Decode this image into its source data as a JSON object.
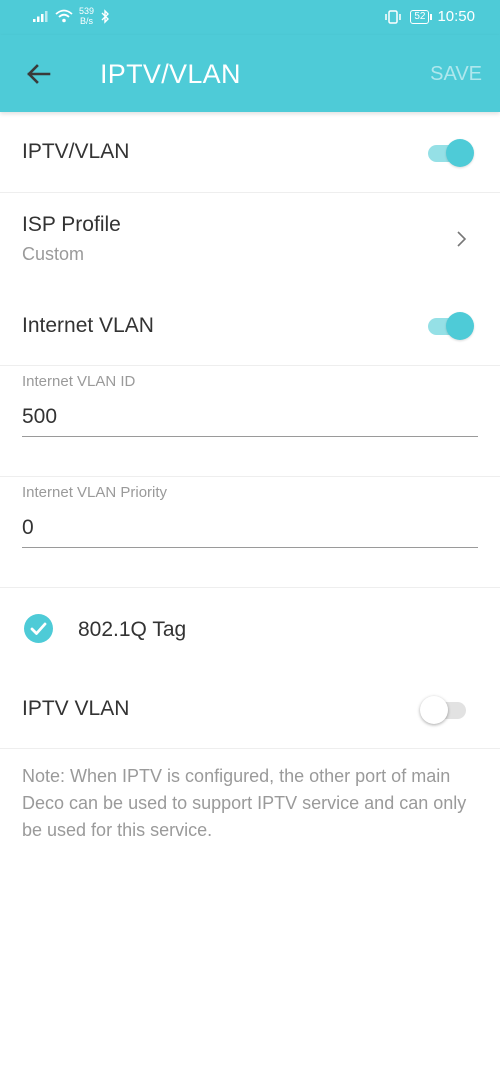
{
  "status_bar": {
    "net_speed_value": "539",
    "net_speed_unit": "B/s",
    "battery": "52",
    "time": "10:50"
  },
  "app_bar": {
    "title": "IPTV/VLAN",
    "save_label": "SAVE"
  },
  "settings": {
    "iptv_vlan_master": {
      "label": "IPTV/VLAN",
      "enabled": true
    },
    "isp_profile": {
      "label": "ISP Profile",
      "value": "Custom"
    },
    "internet_vlan": {
      "label": "Internet VLAN",
      "enabled": true
    },
    "internet_vlan_id": {
      "label": "Internet VLAN ID",
      "value": "500"
    },
    "internet_vlan_priority": {
      "label": "Internet VLAN Priority",
      "value": "0"
    },
    "tag_8021q": {
      "label": "802.1Q Tag",
      "checked": true
    },
    "iptv_vlan": {
      "label": "IPTV VLAN",
      "enabled": false
    }
  },
  "note": "Note: When IPTV is configured, the other port of main Deco can be used to support IPTV service and can only be used for this service.",
  "colors": {
    "accent": "#4ecbd7",
    "accent_light": "#95e0e6",
    "text_primary": "#333333",
    "text_secondary": "#9a9a9a"
  }
}
